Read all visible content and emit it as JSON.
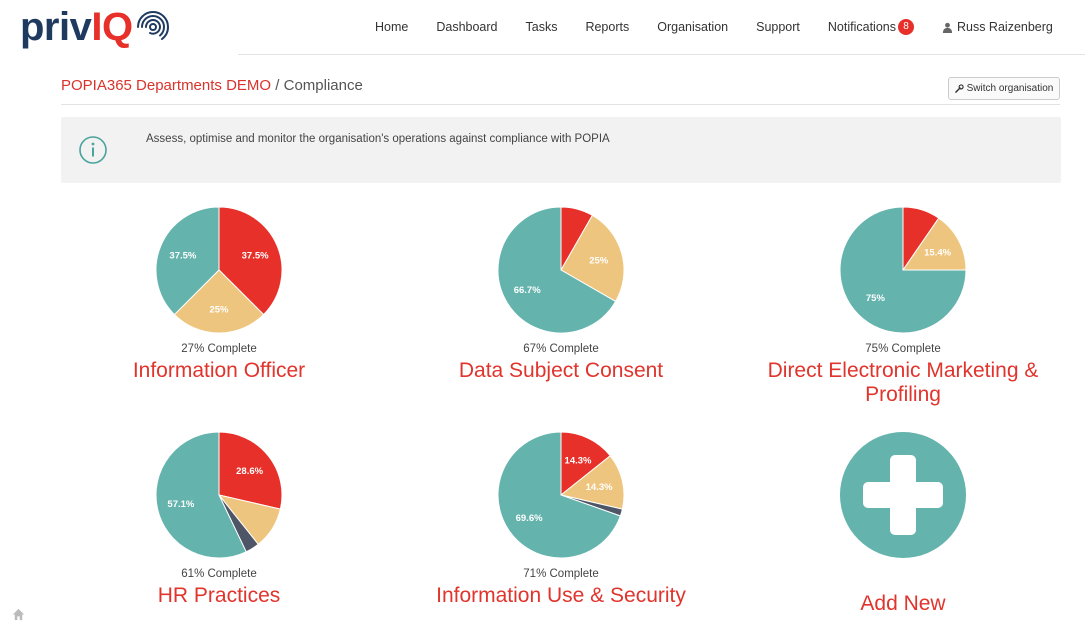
{
  "header": {
    "logo_a": "priv",
    "logo_b": "IQ",
    "nav": [
      "Home",
      "Dashboard",
      "Tasks",
      "Reports",
      "Organisation",
      "Support"
    ],
    "notifications_label": "Notifications",
    "notifications_count": "8",
    "user_name": "Russ Raizenberg"
  },
  "breadcrumb": {
    "org": "POPIA365 Departments DEMO",
    "separator": "/",
    "page": "Compliance"
  },
  "switch_button": "Switch organisation",
  "info_text": "Assess, optimise and monitor the organisation's operations against compliance with POPIA",
  "colors": {
    "red": "#e8302a",
    "tan": "#eec57e",
    "teal": "#64b3ad",
    "slate": "#4d5566",
    "title_red": "#e0342c"
  },
  "cards": [
    {
      "title": "Information Officer",
      "complete": "27% Complete",
      "slices": [
        {
          "value": 37.5,
          "color": "red",
          "label": "37.5%"
        },
        {
          "value": 25,
          "color": "tan",
          "label": "25%"
        },
        {
          "value": 37.5,
          "color": "teal",
          "label": "37.5%"
        }
      ]
    },
    {
      "title": "Data Subject Consent",
      "complete": "67% Complete",
      "slices": [
        {
          "value": 8.3,
          "color": "red",
          "label": ""
        },
        {
          "value": 25,
          "color": "tan",
          "label": "25%"
        },
        {
          "value": 66.7,
          "color": "teal",
          "label": "66.7%"
        }
      ]
    },
    {
      "title": "Direct Electronic Marketing & Profiling",
      "complete": "75% Complete",
      "slices": [
        {
          "value": 9.6,
          "color": "red",
          "label": ""
        },
        {
          "value": 15.4,
          "color": "tan",
          "label": "15.4%"
        },
        {
          "value": 75,
          "color": "teal",
          "label": "75%"
        }
      ]
    },
    {
      "title": "HR Practices",
      "complete": "61% Complete",
      "slices": [
        {
          "value": 28.6,
          "color": "red",
          "label": "28.6%"
        },
        {
          "value": 10.7,
          "color": "tan",
          "label": ""
        },
        {
          "value": 3.6,
          "color": "slate",
          "label": ""
        },
        {
          "value": 57.1,
          "color": "teal",
          "label": "57.1%"
        }
      ]
    },
    {
      "title": "Information Use & Security",
      "complete": "71% Complete",
      "slices": [
        {
          "value": 14.3,
          "color": "red",
          "label": "14.3%"
        },
        {
          "value": 14.3,
          "color": "tan",
          "label": "14.3%"
        },
        {
          "value": 1.8,
          "color": "slate",
          "label": ""
        },
        {
          "value": 69.6,
          "color": "teal",
          "label": "69.6%"
        }
      ]
    }
  ],
  "add_new": {
    "title": "Add New"
  }
}
